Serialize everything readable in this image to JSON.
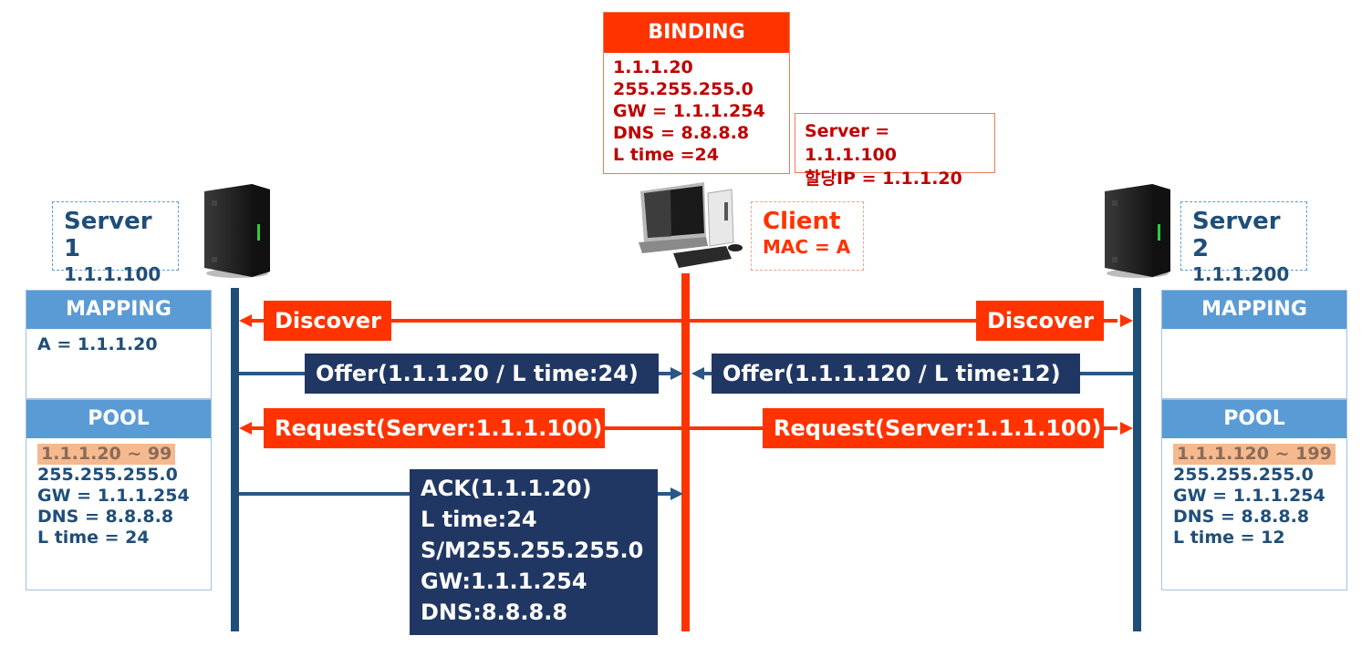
{
  "binding": {
    "title": "BINDING",
    "lines": [
      "1.1.1.20",
      "255.255.255.0",
      "GW = 1.1.1.254",
      "DNS = 8.8.8.8",
      "L time =24"
    ]
  },
  "assignment": {
    "lines": [
      "Server = 1.1.1.100",
      "할당IP = 1.1.1.20"
    ]
  },
  "server1": {
    "name": "Server 1",
    "ip": "1.1.1.100",
    "icon": "server-tower-icon",
    "mapping": {
      "title": "MAPPING",
      "lines": [
        "A = 1.1.1.20"
      ]
    },
    "pool": {
      "title": "POOL",
      "range": "1.1.1.20 ~ 99",
      "lines": [
        "255.255.255.0",
        "GW = 1.1.1.254",
        "DNS = 8.8.8.8",
        "L time = 24"
      ]
    }
  },
  "server2": {
    "name": "Server 2",
    "ip": "1.1.1.200",
    "icon": "server-tower-icon",
    "mapping": {
      "title": "MAPPING",
      "lines": []
    },
    "pool": {
      "title": "POOL",
      "range": "1.1.1.120 ~ 199",
      "lines": [
        "255.255.255.0",
        "GW = 1.1.1.254",
        "DNS = 8.8.8.8",
        "L time = 12"
      ]
    }
  },
  "client": {
    "name": "Client",
    "mac": "MAC = A",
    "icon": "desktop-computer-icon"
  },
  "messages": {
    "discover_left": "Discover",
    "discover_right": "Discover",
    "offer_left": "Offer(1.1.1.20 / L time:24)",
    "offer_right": "Offer(1.1.1.120 / L time:12)",
    "request_left": "Request(Server:1.1.1.100)",
    "request_right": "Request(Server:1.1.1.100)",
    "ack": [
      "ACK(1.1.1.20)",
      "L time:24",
      "S/M255.255.255.0",
      "GW:1.1.1.254",
      "DNS:8.8.8.8"
    ]
  },
  "colors": {
    "server_blue": "#1f4e79",
    "client_red": "#ff3300",
    "message_navy": "#213763",
    "panel_header": "#5b9bd5",
    "binding_text": "#c00000",
    "pool_highlight": "#f4b98f"
  }
}
